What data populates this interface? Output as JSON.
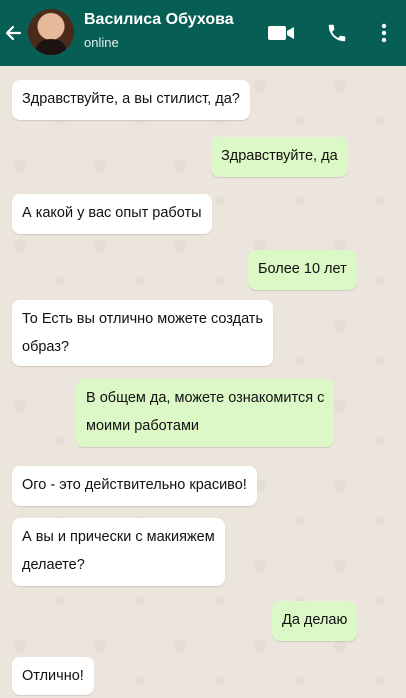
{
  "header": {
    "contact_name": "Василиса Обухова",
    "status": "online",
    "back_icon": "arrow-left-icon",
    "video_icon": "video-call-icon",
    "call_icon": "phone-icon",
    "menu_icon": "more-vertical-icon"
  },
  "colors": {
    "header": "#075e54",
    "incoming": "#ffffff",
    "outgoing": "#dcf8c6",
    "background": "#ece5dd"
  },
  "messages": [
    {
      "direction": "in",
      "text": "Здравствуйте, а вы стилист, да?"
    },
    {
      "direction": "out",
      "text": "Здравствуйте, да"
    },
    {
      "direction": "in",
      "text": "А какой у вас опыт работы"
    },
    {
      "direction": "out",
      "text": "Более 10 лет"
    },
    {
      "direction": "in",
      "lines": [
        "То Есть вы отлично можете создать",
        "образ?"
      ]
    },
    {
      "direction": "out",
      "lines": [
        "В общем да, можете ознакомится с",
        "моими работами"
      ]
    },
    {
      "direction": "in",
      "text": "Ого - это действительно красиво!"
    },
    {
      "direction": "in",
      "lines": [
        "А вы и прически с макияжем",
        "делаете?"
      ]
    },
    {
      "direction": "out",
      "text": "Да делаю"
    },
    {
      "direction": "in",
      "text": "Отлично!"
    }
  ]
}
